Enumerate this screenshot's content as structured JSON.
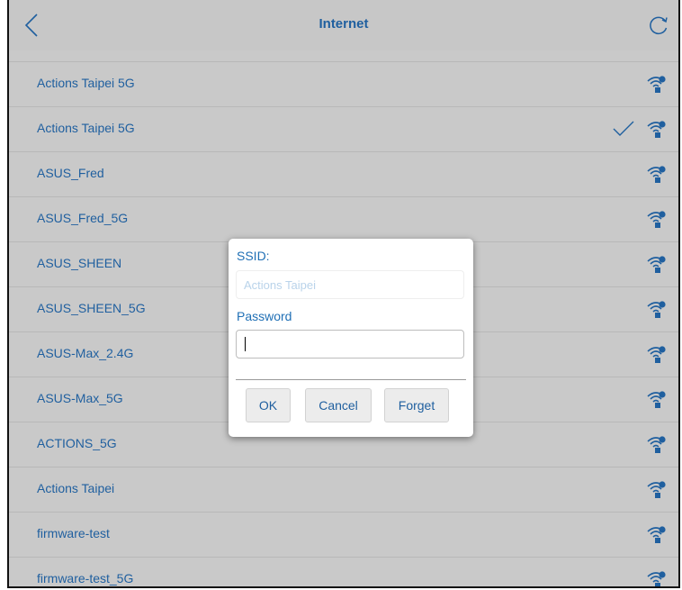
{
  "header": {
    "title": "Internet",
    "back_icon": "chevron-left-icon",
    "refresh_icon": "refresh-icon"
  },
  "networks": [
    {
      "ssid": "Actions Taipei 5G",
      "connected": false
    },
    {
      "ssid": "Actions Taipei 5G",
      "connected": true
    },
    {
      "ssid": "ASUS_Fred",
      "connected": false
    },
    {
      "ssid": "ASUS_Fred_5G",
      "connected": false
    },
    {
      "ssid": "ASUS_SHEEN",
      "connected": false
    },
    {
      "ssid": "ASUS_SHEEN_5G",
      "connected": false
    },
    {
      "ssid": "ASUS-Max_2.4G",
      "connected": false
    },
    {
      "ssid": "ASUS-Max_5G",
      "connected": false
    },
    {
      "ssid": "ACTIONS_5G",
      "connected": false
    },
    {
      "ssid": "Actions Taipei",
      "connected": false
    },
    {
      "ssid": "firmware-test",
      "connected": false
    },
    {
      "ssid": "firmware-test_5G",
      "connected": false
    }
  ],
  "dialog": {
    "ssid_label": "SSID:",
    "ssid_placeholder": "Actions Taipei",
    "password_label": "Password",
    "password_value": "",
    "ok_label": "OK",
    "cancel_label": "Cancel",
    "forget_label": "Forget"
  },
  "colors": {
    "text_blue": "#1f5f9f",
    "label_blue": "#1f6fb5",
    "background": "#c9c9c9"
  }
}
